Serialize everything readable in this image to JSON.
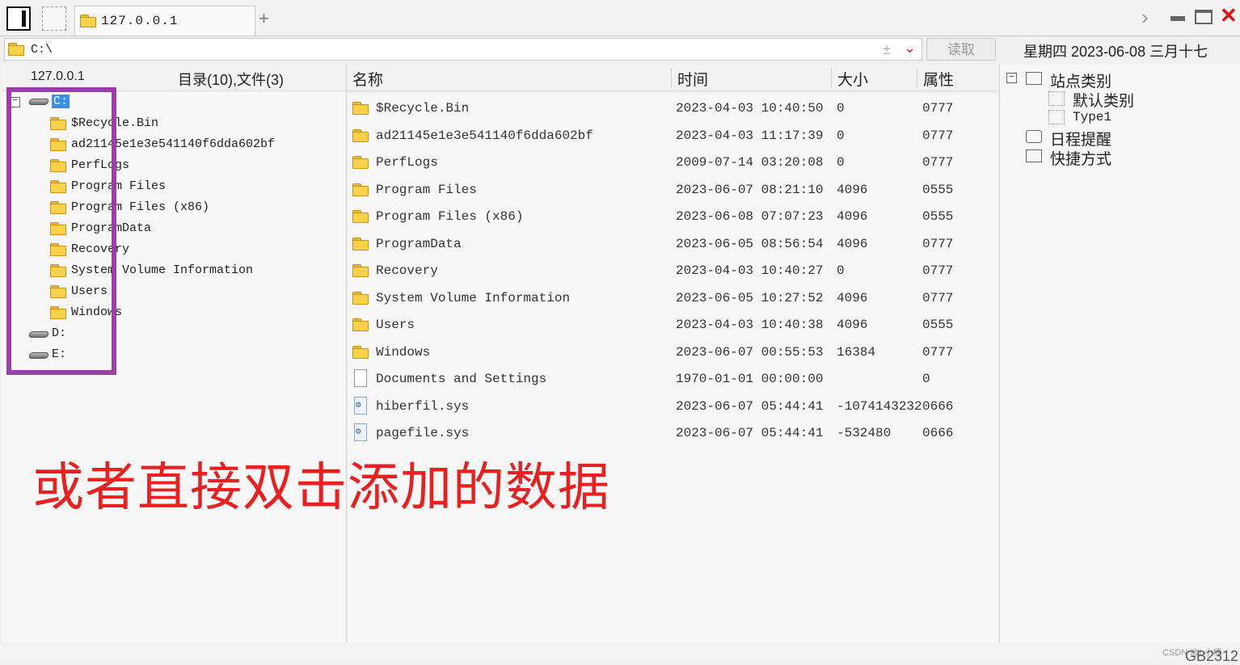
{
  "tab": {
    "title": "127.0.0.1",
    "add_label": "+"
  },
  "address": {
    "path": "C:\\",
    "read_button": "读取"
  },
  "date_line": "星期四 2023-06-08 三月十七",
  "tree": {
    "host": "127.0.0.1",
    "stats": "目录(10),文件(3)",
    "drives": [
      {
        "label": "C:",
        "children": [
          "$Recycle.Bin",
          "ad21145e1e3e541140f6dda602bf",
          "PerfLogs",
          "Program Files",
          "Program Files (x86)",
          "ProgramData",
          "Recovery",
          "System Volume Information",
          "Users",
          "Windows"
        ]
      },
      {
        "label": "D:"
      },
      {
        "label": "E:"
      }
    ]
  },
  "columns": {
    "name": "名称",
    "time": "时间",
    "size": "大小",
    "attr": "属性"
  },
  "files": [
    {
      "icon": "folder-icon",
      "name": "$Recycle.Bin",
      "time": "2023-04-03 10:40:50",
      "size": "0",
      "attr": "0777"
    },
    {
      "icon": "folder-icon",
      "name": "ad21145e1e3e541140f6dda602bf",
      "time": "2023-04-03 11:17:39",
      "size": "0",
      "attr": "0777"
    },
    {
      "icon": "folder-icon",
      "name": "PerfLogs",
      "time": "2009-07-14 03:20:08",
      "size": "0",
      "attr": "0777"
    },
    {
      "icon": "folder-icon",
      "name": "Program Files",
      "time": "2023-06-07 08:21:10",
      "size": "4096",
      "attr": "0555"
    },
    {
      "icon": "folder-icon",
      "name": "Program Files (x86)",
      "time": "2023-06-08 07:07:23",
      "size": "4096",
      "attr": "0555"
    },
    {
      "icon": "folder-icon",
      "name": "ProgramData",
      "time": "2023-06-05 08:56:54",
      "size": "4096",
      "attr": "0777"
    },
    {
      "icon": "folder-icon",
      "name": "Recovery",
      "time": "2023-04-03 10:40:27",
      "size": "0",
      "attr": "0777"
    },
    {
      "icon": "folder-icon",
      "name": "System Volume Information",
      "time": "2023-06-05 10:27:52",
      "size": "4096",
      "attr": "0777"
    },
    {
      "icon": "folder-icon",
      "name": "Users",
      "time": "2023-04-03 10:40:38",
      "size": "4096",
      "attr": "0555"
    },
    {
      "icon": "folder-icon",
      "name": "Windows",
      "time": "2023-06-07 00:55:53",
      "size": "16384",
      "attr": "0777"
    },
    {
      "icon": "file-icon",
      "name": "Documents and Settings",
      "time": "1970-01-01 00:00:00",
      "size": "",
      "attr": "0"
    },
    {
      "icon": "system-file-icon",
      "name": "hiberfil.sys",
      "time": "2023-06-07 05:44:41",
      "size": "-1074143232",
      "attr": "0666"
    },
    {
      "icon": "system-file-icon",
      "name": "pagefile.sys",
      "time": "2023-06-07 05:44:41",
      "size": "-532480",
      "attr": "0666"
    }
  ],
  "sidebar": {
    "site_category": "站点类别",
    "categories": [
      "默认类别",
      "Type1"
    ],
    "schedule": "日程提醒",
    "shortcuts": "快捷方式"
  },
  "caption": "或者直接双击添加的数据",
  "watermark": "CSDN @L小楠",
  "encoding": "GB2312"
}
